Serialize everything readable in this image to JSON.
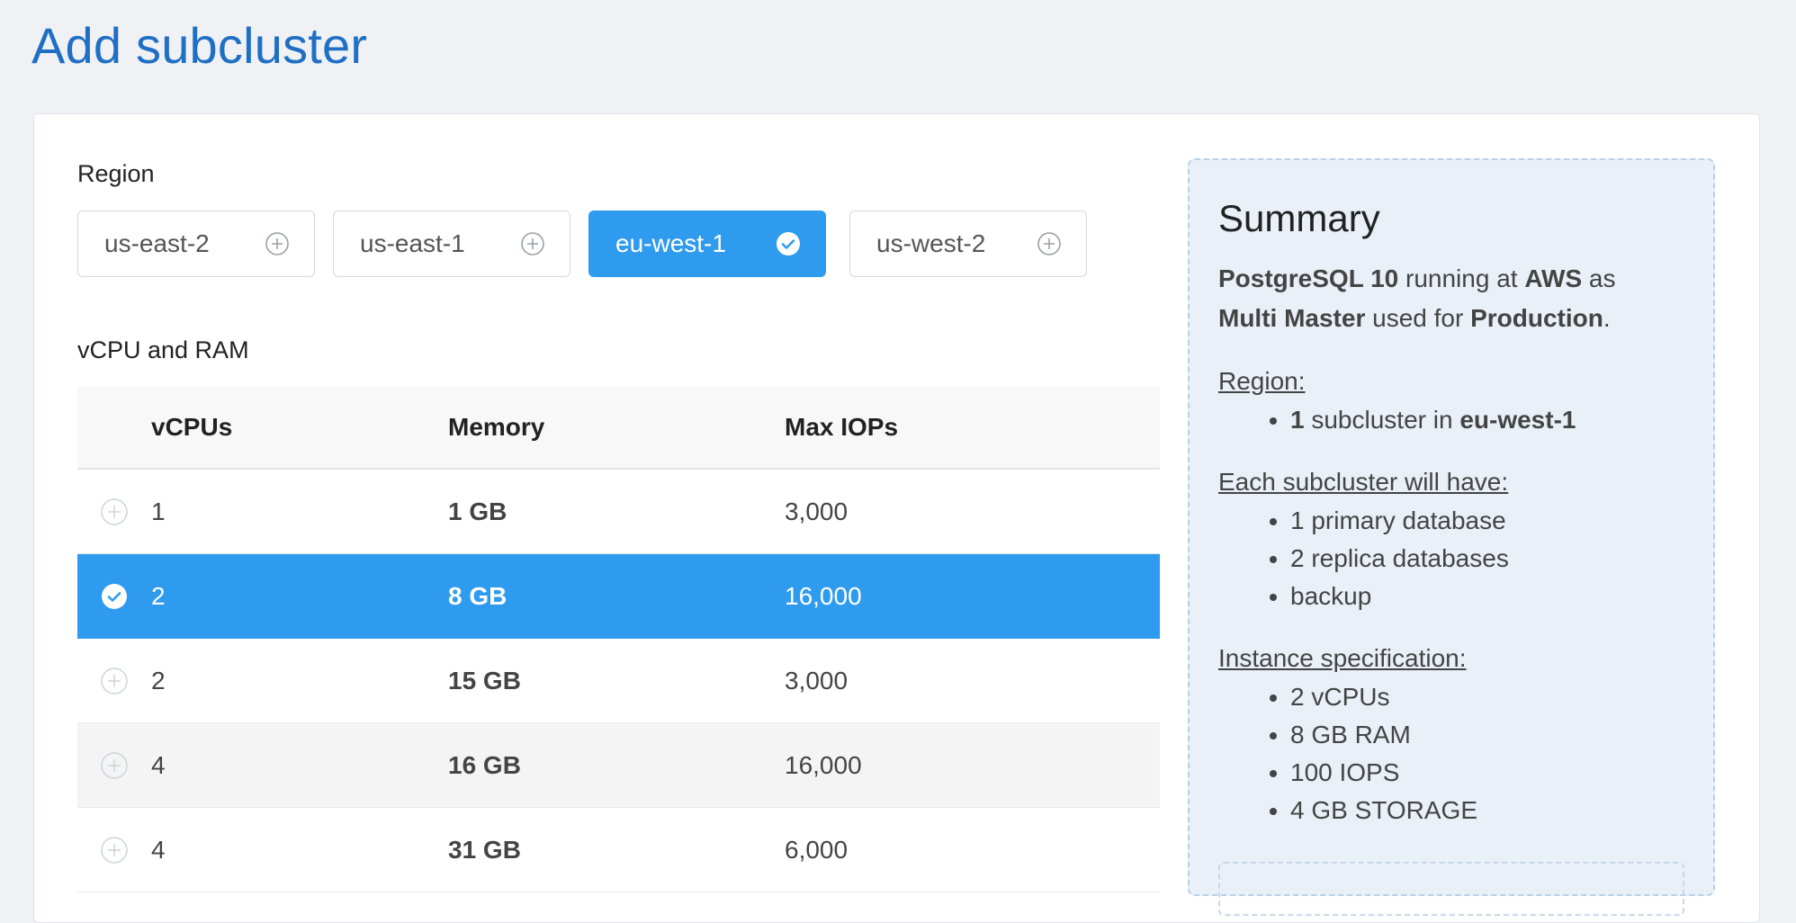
{
  "page": {
    "title": "Add subcluster"
  },
  "region": {
    "label": "Region",
    "options": [
      {
        "name": "us-east-2",
        "selected": false,
        "icon": "plus-circle-icon"
      },
      {
        "name": "us-east-1",
        "selected": false,
        "icon": "plus-circle-icon"
      },
      {
        "name": "eu-west-1",
        "selected": true,
        "icon": "check-circle-icon"
      },
      {
        "name": "us-west-2",
        "selected": false,
        "icon": "plus-circle-icon"
      }
    ]
  },
  "compute": {
    "label": "vCPU and RAM",
    "columns": {
      "vcpus": "vCPUs",
      "memory": "Memory",
      "iops": "Max IOPs"
    },
    "rows": [
      {
        "vcpus": "1",
        "memory": "1 GB",
        "iops": "3,000",
        "selected": false
      },
      {
        "vcpus": "2",
        "memory": "8 GB",
        "iops": "16,000",
        "selected": true
      },
      {
        "vcpus": "2",
        "memory": "15 GB",
        "iops": "3,000",
        "selected": false
      },
      {
        "vcpus": "4",
        "memory": "16 GB",
        "iops": "16,000",
        "selected": false
      },
      {
        "vcpus": "4",
        "memory": "31 GB",
        "iops": "6,000",
        "selected": false
      }
    ]
  },
  "summary": {
    "title": "Summary",
    "engine": "PostgreSQL 10",
    "running_at": "running at",
    "provider": "AWS",
    "as": "as",
    "topology": "Multi Master",
    "used_for": "used for",
    "environment": "Production",
    "period": ".",
    "region_heading": "Region:",
    "region_count": "1",
    "region_text": "subcluster in",
    "region_name": "eu-west-1",
    "each_heading": "Each subcluster will have:",
    "each_items": [
      "1 primary database",
      "2 replica databases",
      "backup"
    ],
    "instance_heading": "Instance specification:",
    "instance_items": [
      "2 vCPUs",
      "8 GB RAM",
      "100 IOPS",
      "4 GB STORAGE"
    ]
  },
  "colors": {
    "accent": "#2f9bee",
    "title": "#1f6fc5",
    "summary_bg": "#e9f0f8"
  }
}
